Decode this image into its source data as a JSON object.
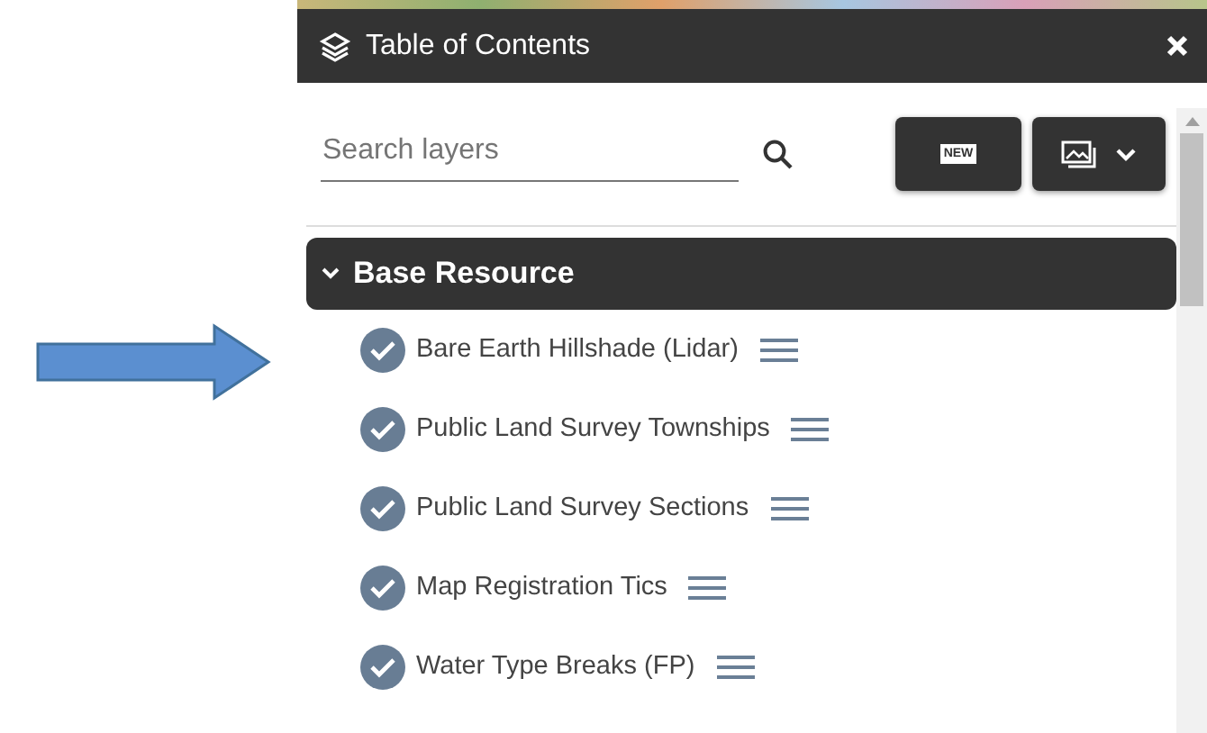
{
  "panel": {
    "title": "Table of Contents"
  },
  "search": {
    "placeholder": "Search layers"
  },
  "toolbar": {
    "new_button": {
      "label": "NEW"
    }
  },
  "groups": [
    {
      "label": "Base Resource",
      "expanded": true,
      "layers": [
        {
          "label": "Bare Earth Hillshade (Lidar)",
          "checked": true
        },
        {
          "label": "Public Land Survey Townships",
          "checked": true
        },
        {
          "label": "Public Land Survey Sections",
          "checked": true
        },
        {
          "label": "Map Registration Tics",
          "checked": true
        },
        {
          "label": "Water Type Breaks (FP)",
          "checked": true
        }
      ]
    }
  ]
}
